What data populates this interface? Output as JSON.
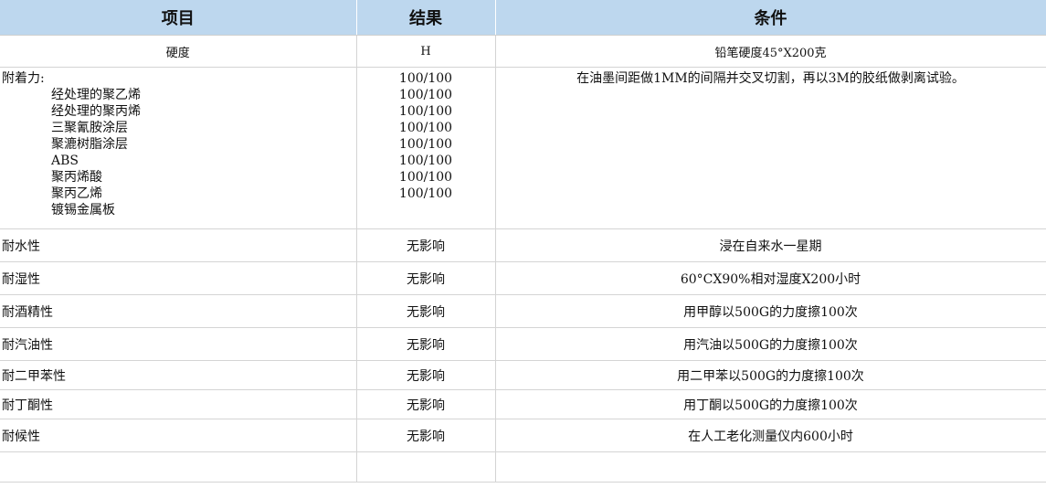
{
  "headers": {
    "item": "项目",
    "result": "结果",
    "condition": "条件"
  },
  "hardness": {
    "item": "硬度",
    "result": "H",
    "condition": "铅笔硬度45°X200克"
  },
  "adhesion": {
    "item": "附着力:",
    "condition": "在油墨间距做1MM的间隔并交叉切割，再以3M的胶纸做剥离试验。",
    "substrates": [
      {
        "name": "经处理的聚乙烯",
        "result": "100/100"
      },
      {
        "name": "经处理的聚丙烯",
        "result": "100/100"
      },
      {
        "name": "三聚氰胺涂层",
        "result": "100/100"
      },
      {
        "name": "聚漉树脂涂层",
        "result": "100/100"
      },
      {
        "name": "ABS",
        "result": "100/100"
      },
      {
        "name": "聚丙烯酸",
        "result": "100/100"
      },
      {
        "name": "聚丙乙烯",
        "result": "100/100"
      },
      {
        "name": "镀锡金属板",
        "result": "100/100"
      }
    ]
  },
  "rows": [
    {
      "item": "耐水性",
      "result": "无影响",
      "condition": "浸在自来水一星期"
    },
    {
      "item": "耐湿性",
      "result": "无影响",
      "condition": "60°CX90%相对湿度X200小时"
    },
    {
      "item": "耐酒精性",
      "result": "无影响",
      "condition": "用甲醇以500G的力度擦100次"
    },
    {
      "item": "耐汽油性",
      "result": "无影响",
      "condition": "用汽油以500G的力度擦100次"
    },
    {
      "item": "耐二甲苯性",
      "result": "无影响",
      "condition": "用二甲苯以500G的力度擦100次"
    },
    {
      "item": "耐丁酮性",
      "result": "无影响",
      "condition": "用丁酮以500G的力度擦100次"
    },
    {
      "item": "耐候性",
      "result": "无影响",
      "condition": "在人工老化测量仪内600小时"
    }
  ]
}
